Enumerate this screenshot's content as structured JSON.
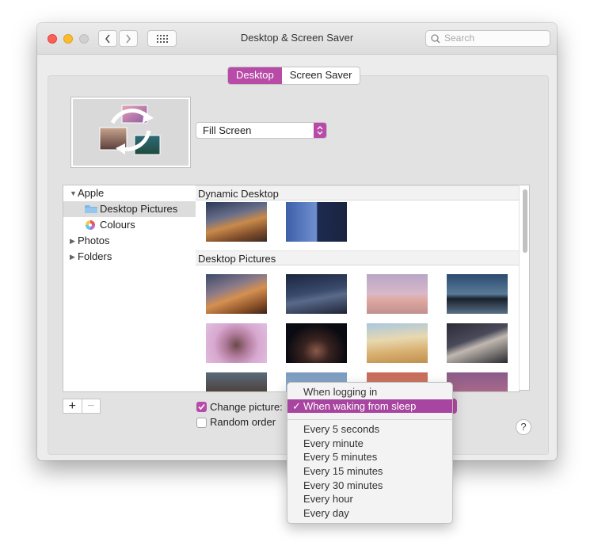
{
  "window": {
    "title": "Desktop & Screen Saver"
  },
  "search": {
    "placeholder": "Search"
  },
  "tabs": [
    {
      "label": "Desktop",
      "selected": true
    },
    {
      "label": "Screen Saver",
      "selected": false
    }
  ],
  "fit_dropdown": {
    "value": "Fill Screen"
  },
  "sidebar": {
    "items": [
      {
        "label": "Apple",
        "expanded": true
      },
      {
        "label": "Desktop Pictures",
        "selected": true
      },
      {
        "label": "Colours"
      },
      {
        "label": "Photos",
        "expanded": false
      },
      {
        "label": "Folders",
        "expanded": false
      }
    ]
  },
  "grid": {
    "sections": [
      {
        "title": "Dynamic Desktop"
      },
      {
        "title": "Desktop Pictures"
      }
    ]
  },
  "buttons": {
    "add": "+",
    "remove": "−",
    "help": "?"
  },
  "options": {
    "change_picture": {
      "label": "Change picture:",
      "checked": true
    },
    "random_order": {
      "label": "Random order",
      "checked": false
    }
  },
  "popup": {
    "items": [
      {
        "label": "When logging in"
      },
      {
        "label": "When waking from sleep",
        "selected": true
      },
      {
        "label": "Every 5 seconds"
      },
      {
        "label": "Every minute"
      },
      {
        "label": "Every 5 minutes"
      },
      {
        "label": "Every 15 minutes"
      },
      {
        "label": "Every 30 minutes"
      },
      {
        "label": "Every hour"
      },
      {
        "label": "Every day"
      }
    ],
    "check": "✓"
  },
  "colors": {
    "accent": "#b84ba7",
    "menu_highlight": "#a845a0"
  }
}
